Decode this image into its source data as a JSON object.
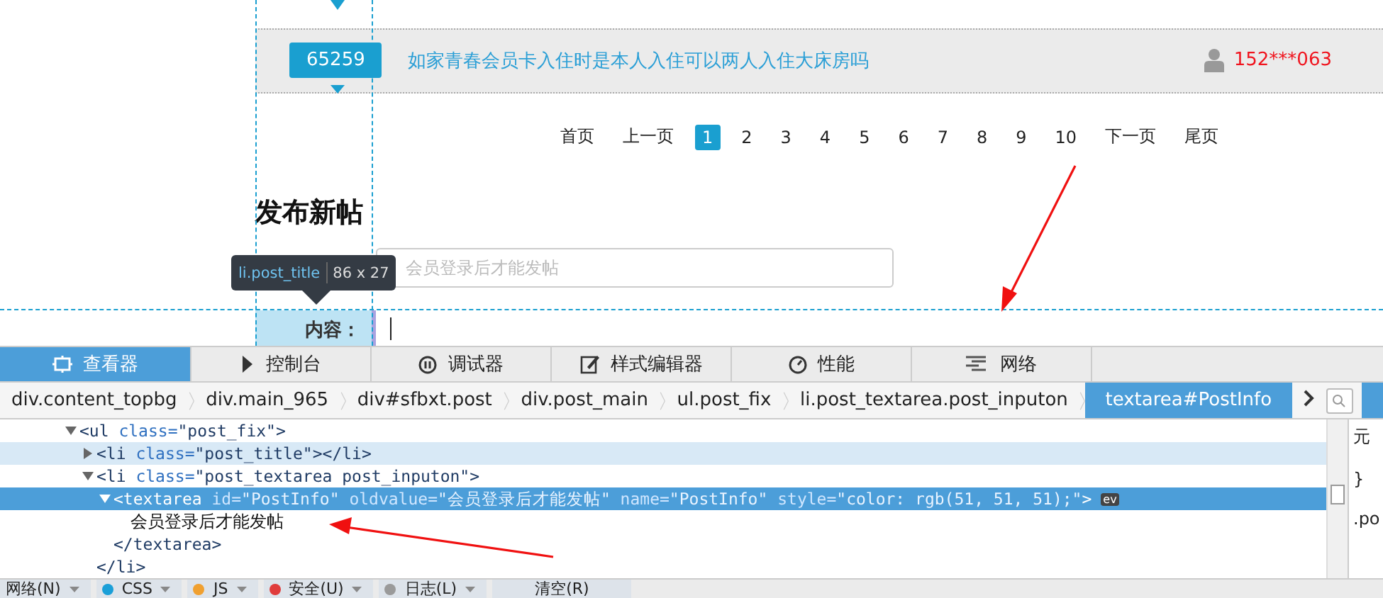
{
  "question": {
    "count": "65259",
    "title": "如家青春会员卡入住时是本人入住可以两人入住大床房吗",
    "user": "152***063"
  },
  "pagination": [
    {
      "label": "首页",
      "selected": false
    },
    {
      "label": "上一页",
      "selected": false
    },
    {
      "label": "1",
      "selected": true
    },
    {
      "label": "2",
      "selected": false
    },
    {
      "label": "3",
      "selected": false
    },
    {
      "label": "4",
      "selected": false
    },
    {
      "label": "5",
      "selected": false
    },
    {
      "label": "6",
      "selected": false
    },
    {
      "label": "7",
      "selected": false
    },
    {
      "label": "8",
      "selected": false
    },
    {
      "label": "9",
      "selected": false
    },
    {
      "label": "10",
      "selected": false
    },
    {
      "label": "下一页",
      "selected": false
    },
    {
      "label": "尾页",
      "selected": false
    }
  ],
  "post_form": {
    "heading": "发布新帖",
    "title_placeholder": "会员登录后才能发帖",
    "content_label": "内容："
  },
  "inspector_tooltip": {
    "selector": "li.post_title",
    "size": "86 x 27"
  },
  "devtools": {
    "tabs": [
      {
        "label": "查看器",
        "kind": "inspector",
        "selected": true
      },
      {
        "label": "控制台",
        "kind": "console",
        "selected": false
      },
      {
        "label": "调试器",
        "kind": "debugger",
        "selected": false
      },
      {
        "label": "样式编辑器",
        "kind": "style",
        "selected": false
      },
      {
        "label": "性能",
        "kind": "performance",
        "selected": false
      },
      {
        "label": "网络",
        "kind": "network",
        "selected": false
      }
    ],
    "breadcrumbs": [
      {
        "label": "div.content_topbg",
        "selected": false
      },
      {
        "label": "div.main_965",
        "selected": false
      },
      {
        "label": "div#sfbxt.post",
        "selected": false
      },
      {
        "label": "div.post_main",
        "selected": false
      },
      {
        "label": "ul.post_fix",
        "selected": false
      },
      {
        "label": "li.post_textarea.post_inputon",
        "selected": false
      },
      {
        "label": "textarea#PostInfo",
        "selected": true
      }
    ],
    "markup": [
      {
        "tokens": [
          {
            "kind": "tag",
            "text": "<ul"
          },
          {
            "kind": "attr",
            "text": " class="
          },
          {
            "kind": "value",
            "text": "\"post_fix\""
          },
          {
            "kind": "tag",
            "text": ">"
          }
        ],
        "expanded": true,
        "selected": false,
        "highlighted": false,
        "children": [
          {
            "tokens": [
              {
                "kind": "tag",
                "text": "<li"
              },
              {
                "kind": "attr",
                "text": " class="
              },
              {
                "kind": "value",
                "text": "\"post_title\""
              },
              {
                "kind": "tag",
                "text": "></li>"
              }
            ],
            "expanded": false,
            "selected": false,
            "highlighted": true
          },
          {
            "tokens": [
              {
                "kind": "tag",
                "text": "<li"
              },
              {
                "kind": "attr",
                "text": " class="
              },
              {
                "kind": "value",
                "text": "\"post_textarea post_inputon\""
              },
              {
                "kind": "tag",
                "text": ">"
              }
            ],
            "expanded": true,
            "selected": false,
            "highlighted": false,
            "children": [
              {
                "tokens": [
                  {
                    "kind": "tag",
                    "text": "<textarea"
                  },
                  {
                    "kind": "attr",
                    "text": " id="
                  },
                  {
                    "kind": "value",
                    "text": "\"PostInfo\""
                  },
                  {
                    "kind": "attr",
                    "text": " oldvalue="
                  },
                  {
                    "kind": "value",
                    "text": "\"会员登录后才能发帖\""
                  },
                  {
                    "kind": "attr",
                    "text": " name="
                  },
                  {
                    "kind": "value",
                    "text": "\"PostInfo\""
                  },
                  {
                    "kind": "attr",
                    "text": " style="
                  },
                  {
                    "kind": "value",
                    "text": "\"color: rgb(51, 51, 51);\""
                  },
                  {
                    "kind": "tag",
                    "text": ">"
                  }
                ],
                "badge": "ev",
                "expanded": true,
                "selected": true,
                "highlighted": false,
                "children": [
                  {
                    "tokens": [
                      {
                        "kind": "text",
                        "text": "会员登录后才能发帖"
                      }
                    ]
                  }
                ],
                "closing": [
                  {
                    "kind": "tag",
                    "text": "</textarea>"
                  }
                ]
              }
            ],
            "closing": [
              {
                "kind": "tag",
                "text": "</li>"
              }
            ]
          }
        ]
      }
    ],
    "sidebar": [
      "元",
      "}",
      ".po"
    ],
    "filters": [
      {
        "label": "网络(N)"
      },
      {
        "label": "CSS",
        "color": "#1a9fd8"
      },
      {
        "label": "JS",
        "color": "#f0a030"
      },
      {
        "label": "安全(U)",
        "color": "#e03c3c"
      },
      {
        "label": "日志(L)",
        "color": "#9a9a9a"
      }
    ],
    "clear_button": "清空(R)"
  }
}
